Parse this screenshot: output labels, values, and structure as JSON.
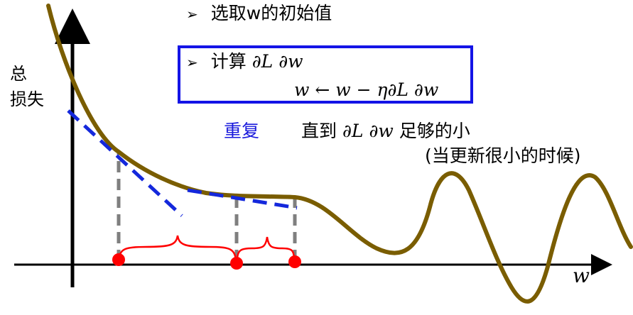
{
  "colors": {
    "curve": "#7a5d00",
    "tangent": "#1428dc",
    "axis": "#000000",
    "dashed_guide": "#7f7f7f",
    "point": "#ff0000",
    "brace": "#ff0000",
    "box_border": "#1414e6",
    "repeat_text": "#1a1adc"
  },
  "axes": {
    "y_label": "总\n损失",
    "x_label": "w"
  },
  "steps": {
    "bullet_symbol": "➢",
    "step1": "选取w的初始值",
    "step2_prefix": "计算",
    "step2_math": "∂L ∂w",
    "update_rule": "w ← w − η∂L ∂w",
    "repeat_word": "重复",
    "until_prefix": "直到",
    "until_math": "∂L ∂w",
    "until_suffix": "足够的小",
    "note": "(当更新很小的时候)"
  }
}
